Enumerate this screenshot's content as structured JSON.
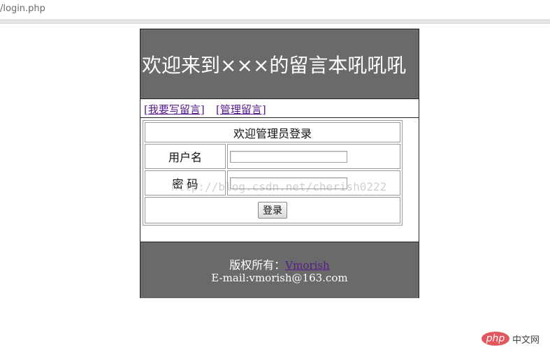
{
  "browser": {
    "url": "/login.php"
  },
  "header": {
    "title": "欢迎来到×××的留言本吼吼吼"
  },
  "nav": {
    "write_link": "[我要写留言]",
    "manage_link": "[管理留言]"
  },
  "login": {
    "title": "欢迎管理员登录",
    "username_label": "用户名",
    "username_value": "",
    "password_label": "密 码",
    "password_value": "",
    "submit_label": "登录"
  },
  "footer": {
    "copyright_label": "版权所有：",
    "author_link": "Vmorish",
    "email": "E-mail:vmorish@163.com"
  },
  "watermark": "http://blog.csdn.net/cherish0222",
  "brand": {
    "logo_text": "php",
    "site_name": "中文网"
  },
  "colors": {
    "header_bg": "#6a6a6a",
    "link": "#551a8b",
    "brand_red": "#e2565d"
  }
}
